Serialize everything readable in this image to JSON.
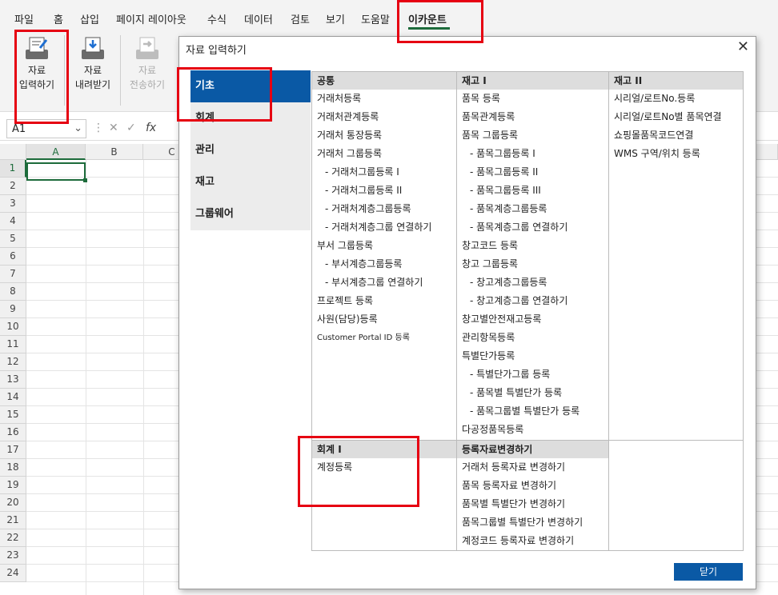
{
  "menubar": {
    "items": [
      "파일",
      "홈",
      "삽입",
      "페이지 레이아웃",
      "수식",
      "데이터",
      "검토",
      "보기",
      "도움말",
      "이카운트"
    ],
    "active": "이카운트"
  },
  "ribbon": {
    "buttons": [
      {
        "line1": "자료",
        "line2": "입력하기",
        "enabled": true
      },
      {
        "line1": "자료",
        "line2": "내려받기",
        "enabled": true
      },
      {
        "line1": "자료",
        "line2": "전송하기",
        "enabled": false
      }
    ]
  },
  "formula_bar": {
    "name_box": "A1",
    "fx": "fx"
  },
  "grid": {
    "columns": [
      "A",
      "B",
      "C"
    ],
    "rows": [
      "1",
      "2",
      "3",
      "4",
      "5",
      "6",
      "7",
      "8",
      "9",
      "10",
      "11",
      "12",
      "13",
      "14",
      "15",
      "16",
      "17",
      "18",
      "19",
      "20",
      "21",
      "22",
      "23",
      "24"
    ]
  },
  "dialog": {
    "title": "자료 입력하기",
    "close_button": "닫기",
    "nav": [
      "기초",
      "회계",
      "관리",
      "재고",
      "그룹웨어"
    ],
    "nav_active": "기초",
    "sections": {
      "common": {
        "header": "공통",
        "items": [
          "거래처등록",
          "거래처관계등록",
          "거래처 통장등록",
          "거래처 그룹등록",
          "- 거래처그룹등록 I",
          "- 거래처그룹등록 II",
          "- 거래처계층그룹등록",
          "- 거래처계층그룹 연결하기",
          "부서 그룹등록",
          "- 부서계층그룹등록",
          "- 부서계층그룹 연결하기",
          "프로젝트 등록",
          "사원(담당)등록",
          "Customer Portal ID 등록"
        ]
      },
      "inventory1": {
        "header": "재고 I",
        "items": [
          "품목 등록",
          "품목관계등록",
          "품목 그룹등록",
          "- 품목그룹등록 I",
          "- 품목그룹등록 II",
          "- 품목그룹등록 III",
          "- 품목계층그룹등록",
          "- 품목계층그룹 연결하기",
          "창고코드 등록",
          "창고 그룹등록",
          "- 창고계층그룹등록",
          "- 창고계층그룹 연결하기",
          "창고별안전재고등록",
          "관리항목등록",
          "특별단가등록",
          "- 특별단가그룹 등록",
          "- 품목별 특별단가 등록",
          "- 품목그룹별 특별단가 등록",
          "다공정품목등록"
        ]
      },
      "inventory2": {
        "header": "재고 II",
        "items": [
          "시리얼/로트No.등록",
          "시리얼/로트No별 품목연결",
          "쇼핑몰품목코드연결",
          "WMS 구역/위치 등록"
        ]
      },
      "accounting1": {
        "header": "회계 I",
        "items": [
          "계정등록"
        ]
      },
      "change": {
        "header": "등록자료변경하기",
        "items": [
          "거래처 등록자료 변경하기",
          "품목 등록자료 변경하기",
          "품목별 특별단가 변경하기",
          "품목그룹별 특별단가 변경하기",
          "계정코드 등록자료 변경하기"
        ]
      }
    }
  },
  "colors": {
    "accent": "#0a59a5",
    "excel_green": "#1d6b3b",
    "highlight": "#e60012"
  }
}
